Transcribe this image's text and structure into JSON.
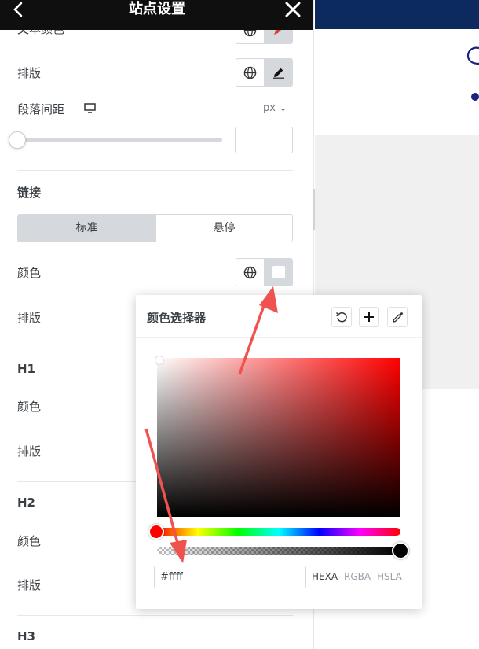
{
  "header": {
    "title": "站点设置"
  },
  "panel": {
    "partial_row": "文本颜色",
    "typography1": "排版",
    "paragraph_spacing": "段落间距",
    "unit": "px ⌄",
    "link_section": "链接",
    "tabs": {
      "normal": "标准",
      "hover": "悬停"
    },
    "link_color": "颜色",
    "link_typography": "排版",
    "h1": {
      "title": "H1",
      "color": "颜色",
      "typography": "排版"
    },
    "h2": {
      "title": "H2",
      "color": "颜色",
      "typography": "排版"
    },
    "h3": {
      "title": "H3"
    }
  },
  "picker": {
    "title": "颜色选择器",
    "hex_value": "#ffff",
    "formats": {
      "hexa": "HEXA",
      "rgba": "RGBA",
      "hsla": "HSLA"
    }
  },
  "colors": {
    "header_bg": "#0f0f0f",
    "preview_top": "#0c2a5e",
    "arrow": "#ef5350",
    "hue_selected": "#ff0000"
  },
  "icons": [
    "back-icon",
    "close-icon",
    "globe-icon",
    "pencil-icon",
    "desktop-icon",
    "reset-icon",
    "plus-icon",
    "eyedropper-icon"
  ]
}
